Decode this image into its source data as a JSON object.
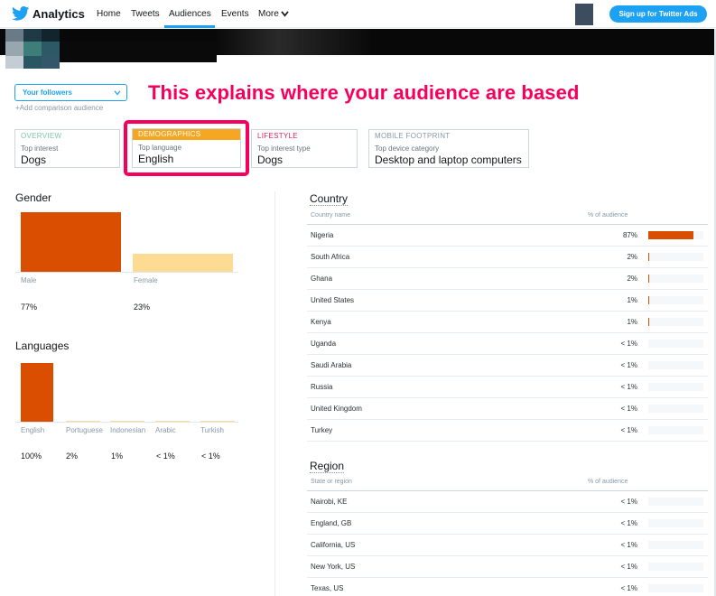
{
  "nav": {
    "brand": "Analytics",
    "items": [
      "Home",
      "Tweets",
      "Audiences",
      "Events",
      "More"
    ],
    "active": "Audiences",
    "signup_label": "Sign up for Twitter Ads"
  },
  "selector": {
    "value": "Your followers",
    "add_comparison": "+Add comparison audience"
  },
  "annotation": "This explains where your audience are based",
  "tabs": [
    {
      "head": "OVERVIEW",
      "sub": "Top interest",
      "value": "Dogs",
      "head_color": "#7bc8a4"
    },
    {
      "head": "DEMOGRAPHICS",
      "sub": "Top language",
      "value": "English",
      "head_color": "#f5a623"
    },
    {
      "head": "LIFESTYLE",
      "sub": "Top interest type",
      "value": "Dogs",
      "head_color": "#e0245e"
    },
    {
      "head": "MOBILE FOOTPRINT",
      "sub": "Top device category",
      "value": "Desktop and laptop computers",
      "head_color": "#8899a6"
    }
  ],
  "gender": {
    "title": "Gender",
    "items": [
      {
        "label": "Male",
        "pct": "77%",
        "value": 77
      },
      {
        "label": "Female",
        "pct": "23%",
        "value": 23
      }
    ]
  },
  "languages": {
    "title": "Languages",
    "items": [
      {
        "label": "English",
        "pct": "100%",
        "value": 100
      },
      {
        "label": "Portuguese",
        "pct": "2%",
        "value": 2
      },
      {
        "label": "Indonesian",
        "pct": "1%",
        "value": 1
      },
      {
        "label": "Arabic",
        "pct": "< 1%",
        "value": 0.5
      },
      {
        "label": "Turkish",
        "pct": "< 1%",
        "value": 0.5
      }
    ]
  },
  "country": {
    "title": "Country",
    "col_name": "Country name",
    "col_pct": "% of audience",
    "rows": [
      {
        "name": "Nigeria",
        "pct": "87%",
        "value": 87
      },
      {
        "name": "South Africa",
        "pct": "2%",
        "value": 2
      },
      {
        "name": "Ghana",
        "pct": "2%",
        "value": 2
      },
      {
        "name": "United States",
        "pct": "1%",
        "value": 1
      },
      {
        "name": "Kenya",
        "pct": "1%",
        "value": 1
      },
      {
        "name": "Uganda",
        "pct": "< 1%",
        "value": 0
      },
      {
        "name": "Saudi Arabia",
        "pct": "< 1%",
        "value": 0
      },
      {
        "name": "Russia",
        "pct": "< 1%",
        "value": 0
      },
      {
        "name": "United Kingdom",
        "pct": "< 1%",
        "value": 0
      },
      {
        "name": "Turkey",
        "pct": "< 1%",
        "value": 0
      }
    ]
  },
  "region": {
    "title": "Region",
    "col_name": "State or region",
    "col_pct": "% of audience",
    "rows": [
      {
        "name": "Nairobi, KE",
        "pct": "< 1%",
        "value": 0
      },
      {
        "name": "England, GB",
        "pct": "< 1%",
        "value": 0
      },
      {
        "name": "California, US",
        "pct": "< 1%",
        "value": 0
      },
      {
        "name": "New York, US",
        "pct": "< 1%",
        "value": 0
      },
      {
        "name": "Texas, US",
        "pct": "< 1%",
        "value": 0
      }
    ]
  },
  "colors": {
    "accent": "#1da1f2",
    "bar_primary": "#d94e00",
    "bar_secondary": "#fddb92",
    "annotation": "#f5005c"
  }
}
